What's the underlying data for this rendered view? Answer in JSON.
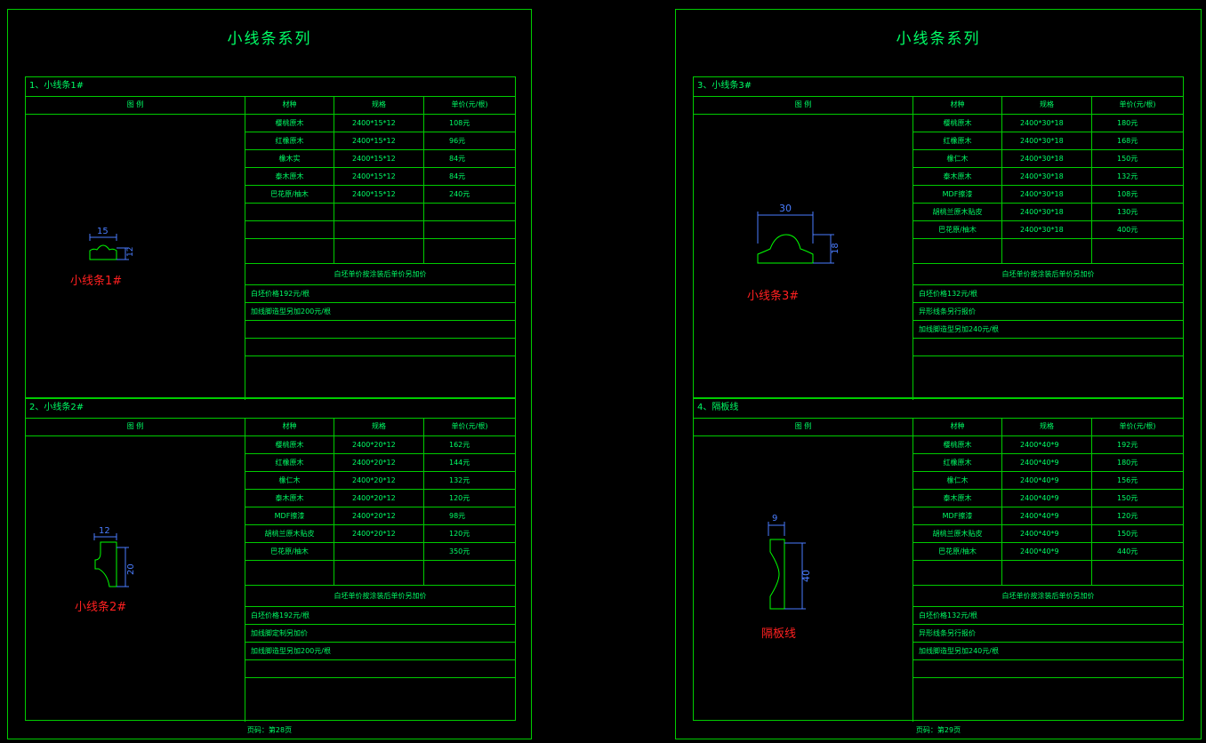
{
  "sheets": [
    {
      "title": "小线条系列",
      "footer": "页码：第28页",
      "sections": [
        {
          "title": "1、小线条1#",
          "header": {
            "fig": "图 例",
            "mat": "材种",
            "spec": "规格",
            "price": "单价(元/根)"
          },
          "rows": [
            {
              "m": "樱桃原木",
              "s": "2400*15*12",
              "p": "108元"
            },
            {
              "m": "红橡原木",
              "s": "2400*15*12",
              "p": "96元"
            },
            {
              "m": "橡木实",
              "s": "2400*15*12",
              "p": "84元"
            },
            {
              "m": "泰木原木",
              "s": "2400*15*12",
              "p": "84元"
            },
            {
              "m": "巴花原/柚木",
              "s": "2400*15*12",
              "p": "240元"
            }
          ],
          "notes_title": "白坯单价按涂装后单价另加价",
          "notes": [
            "白坯价格192元/根",
            "加线脚造型另加200元/根"
          ],
          "fig": {
            "w": "15",
            "h": "12",
            "label": "小线条1#"
          }
        },
        {
          "title": "2、小线条2#",
          "header": {
            "fig": "图 例",
            "mat": "材种",
            "spec": "规格",
            "price": "单价(元/根)"
          },
          "rows": [
            {
              "m": "樱桃原木",
              "s": "2400*20*12",
              "p": "162元"
            },
            {
              "m": "红橡原木",
              "s": "2400*20*12",
              "p": "144元"
            },
            {
              "m": "橡仁木",
              "s": "2400*20*12",
              "p": "132元"
            },
            {
              "m": "泰木原木",
              "s": "2400*20*12",
              "p": "120元"
            },
            {
              "m": "MDF擦漆",
              "s": "2400*20*12",
              "p": "98元"
            },
            {
              "m": "胡桃兰原木贴皮",
              "s": "2400*20*12",
              "p": "120元"
            },
            {
              "m": "巴花原/柚木",
              "s": "",
              "p": "350元"
            }
          ],
          "notes_title": "白坯单价按涂装后单价另加价",
          "notes": [
            "白坯价格192元/根",
            "加线脚定制另加价",
            "加线脚造型另加200元/根"
          ],
          "fig": {
            "w": "12",
            "h": "20",
            "label": "小线条2#"
          }
        }
      ]
    },
    {
      "title": "小线条系列",
      "footer": "页码：第29页",
      "sections": [
        {
          "title": "3、小线条3#",
          "header": {
            "fig": "图 例",
            "mat": "材种",
            "spec": "规格",
            "price": "单价(元/根)"
          },
          "rows": [
            {
              "m": "樱桃原木",
              "s": "2400*30*18",
              "p": "180元"
            },
            {
              "m": "红橡原木",
              "s": "2400*30*18",
              "p": "168元"
            },
            {
              "m": "橡仁木",
              "s": "2400*30*18",
              "p": "150元"
            },
            {
              "m": "泰木原木",
              "s": "2400*30*18",
              "p": "132元"
            },
            {
              "m": "MDF擦漆",
              "s": "2400*30*18",
              "p": "108元"
            },
            {
              "m": "胡桃兰原木贴皮",
              "s": "2400*30*18",
              "p": "130元"
            },
            {
              "m": "巴花原/柚木",
              "s": "2400*30*18",
              "p": "400元"
            }
          ],
          "notes_title": "白坯单价按涂装后单价另加价",
          "notes": [
            "白坯价格132元/根",
            "异形线条另行报价",
            "加线脚造型另加240元/根"
          ],
          "fig": {
            "w": "30",
            "h": "18",
            "label": "小线条3#"
          }
        },
        {
          "title": "4、隔板线",
          "header": {
            "fig": "图 例",
            "mat": "材种",
            "spec": "规格",
            "price": "单价(元/根)"
          },
          "rows": [
            {
              "m": "樱桃原木",
              "s": "2400*40*9",
              "p": "192元"
            },
            {
              "m": "红橡原木",
              "s": "2400*40*9",
              "p": "180元"
            },
            {
              "m": "橡仁木",
              "s": "2400*40*9",
              "p": "156元"
            },
            {
              "m": "泰木原木",
              "s": "2400*40*9",
              "p": "150元"
            },
            {
              "m": "MDF擦漆",
              "s": "2400*40*9",
              "p": "120元"
            },
            {
              "m": "胡桃兰原木贴皮",
              "s": "2400*40*9",
              "p": "150元"
            },
            {
              "m": "巴花原/柚木",
              "s": "2400*40*9",
              "p": "440元"
            }
          ],
          "notes_title": "白坯单价按涂装后单价另加价",
          "notes": [
            "白坯价格132元/根",
            "异形线条另行报价",
            "加线脚造型另加240元/根"
          ],
          "fig": {
            "w": "9",
            "h": "40",
            "label": "隔板线"
          }
        }
      ]
    }
  ]
}
